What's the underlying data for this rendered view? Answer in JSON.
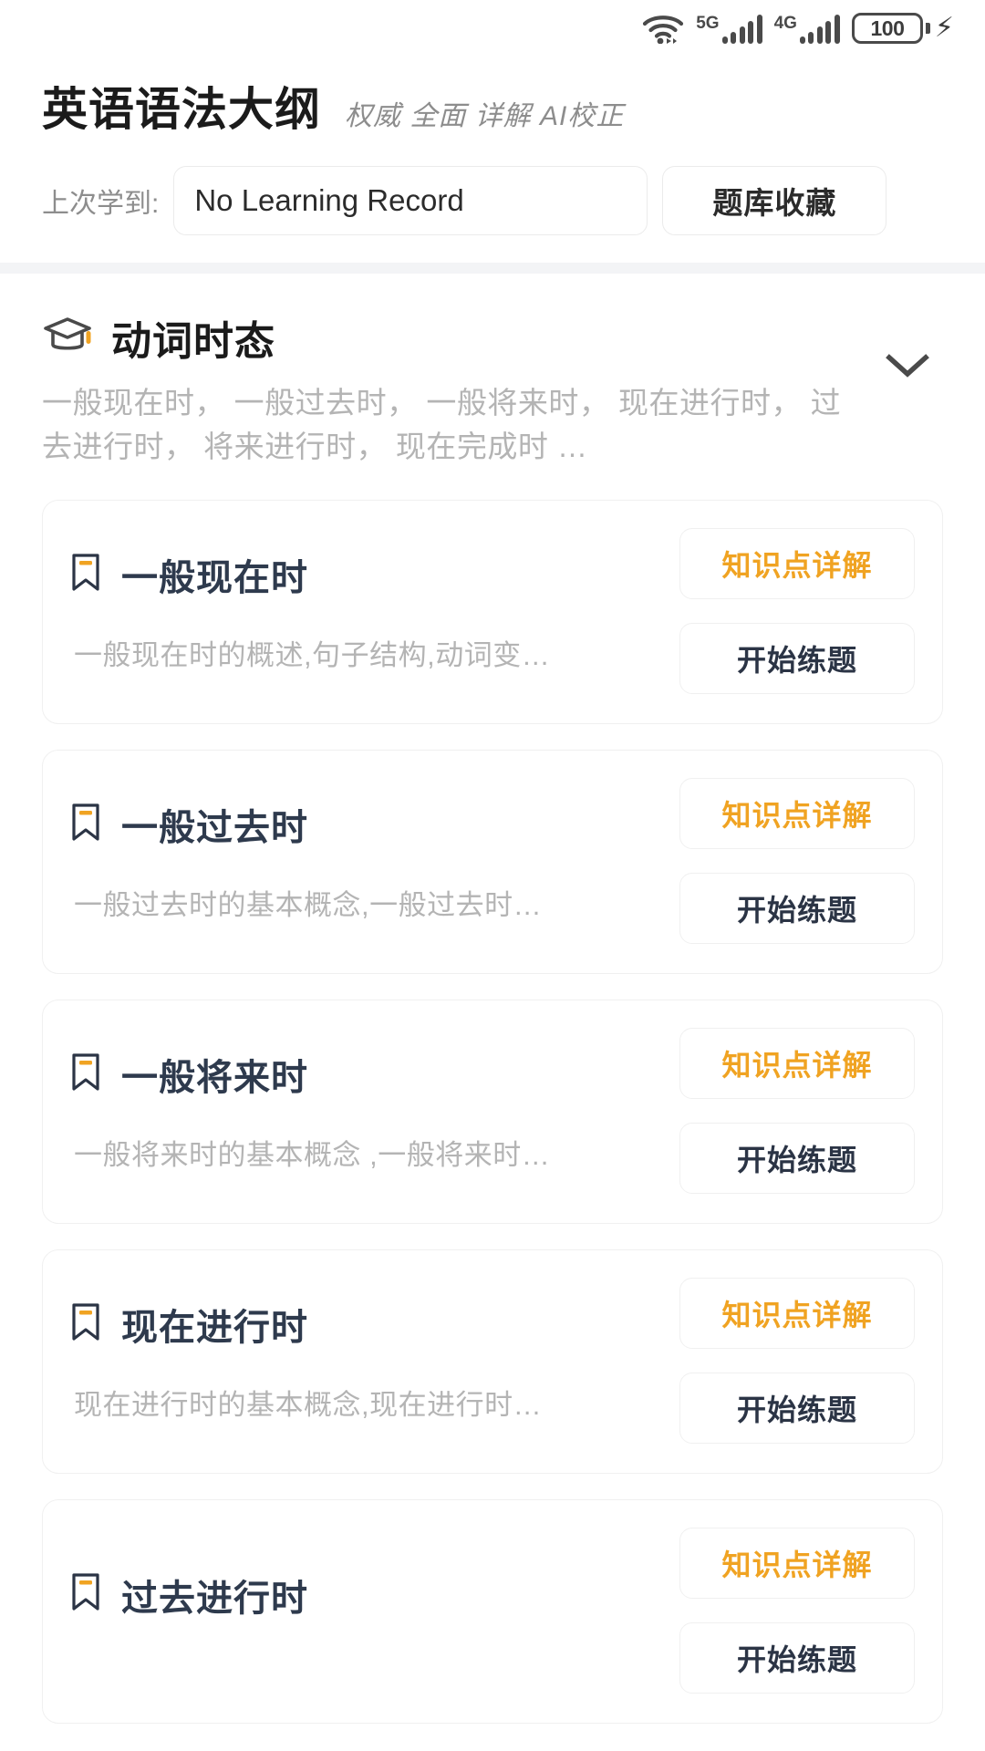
{
  "status_bar": {
    "wifi_icon": "wifi-icon",
    "signal_5g_label": "5G",
    "signal_4g_label": "4G",
    "battery_level": "100",
    "charging_icon": "charging-bolt-icon"
  },
  "header": {
    "app_title": "英语语法大纲",
    "app_subtitle": "权威 全面 详解 AI校正",
    "last_learned_label": "上次学到:",
    "last_learned_value": "No Learning Record",
    "favorites_button": "题库收藏"
  },
  "section": {
    "icon": "graduation-cap-icon",
    "title": "动词时态",
    "description": "一般现在时， 一般过去时， 一般将来时， 现在进行时， 过去进行时， 将来进行时， 现在完成时 …",
    "collapse_icon": "chevron-down-icon"
  },
  "buttons": {
    "detail_label": "知识点详解",
    "practice_label": "开始练题"
  },
  "colors": {
    "accent_orange": "#f0a322",
    "title_navy": "#2e3a4d",
    "muted_gray": "#b4b4b4"
  },
  "cards": [
    {
      "bookmark_icon": "bookmark-icon",
      "title": "一般现在时",
      "description": "一般现在时的概述,句子结构,动词变…"
    },
    {
      "bookmark_icon": "bookmark-icon",
      "title": "一般过去时",
      "description": "一般过去时的基本概念,一般过去时…"
    },
    {
      "bookmark_icon": "bookmark-icon",
      "title": "一般将来时",
      "description": "一般将来时的基本概念 ,一般将来时…"
    },
    {
      "bookmark_icon": "bookmark-icon",
      "title": "现在进行时",
      "description": "现在进行时的基本概念,现在进行时…"
    },
    {
      "bookmark_icon": "bookmark-icon",
      "title": "过去进行时",
      "description": ""
    }
  ]
}
